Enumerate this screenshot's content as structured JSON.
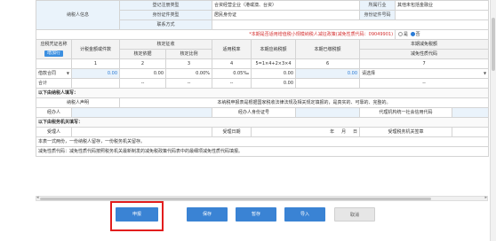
{
  "taxpayer_info": {
    "section_label": "纳税人信息",
    "reg_type_label": "登记注册类型",
    "reg_type_value": "合资经营企业（港或澳、台资）",
    "industry_label": "所属行业",
    "industry_value": "其他未包括金融业",
    "id_type_label": "身份证件类型",
    "id_type_value": "居民身份证",
    "id_no_label": "身份证件号码",
    "contact_label": "联系方式"
  },
  "policy_row": {
    "text": "*本期是否适用增值税小规模纳税人减征政策(减免性质代码：09049901)",
    "yes_label": "是",
    "no_label": "否"
  },
  "headers": {
    "voucher_name": "应税凭证名称",
    "add_button": "增加行",
    "taxable_amount": "计税金额或件数",
    "approved_levy": "核定征收",
    "approved_basis": "核定依据",
    "approved_ratio": "核定比例",
    "tax_rate": "适用税率",
    "tax_payable": "本期应纳税额",
    "tax_paid": "本期已缴税额",
    "relief_label": "本期减免税额",
    "relief_code": "减免性质代码",
    "nums": [
      "1",
      "2",
      "3",
      "4",
      "5=1×4+2×3×4",
      "6",
      "7"
    ]
  },
  "rows": [
    {
      "name": "借款合同",
      "amount": "0.00",
      "basis": "0.00",
      "ratio": "0.00%",
      "rate": "0.05‰",
      "payable": "0.00",
      "paid": "0.00",
      "relief": "请选择"
    }
  ],
  "total_row": {
    "label": "合计",
    "dashes": [
      "--",
      "--",
      "--",
      "--"
    ],
    "payable": "0.00"
  },
  "taxpayer_fill": {
    "heading": "以下由纳税人填写：",
    "declaration_label": "纳税人声明",
    "declaration_text": "本纳税申报表是根据国家税收法律法规及相关规定填报的，是真实的、可靠的、完整的。",
    "agent_label": "经办人",
    "agent_id_label": "经办人身份证号",
    "agency_label": "代理机构统一社会信用代码"
  },
  "tax_office_fill": {
    "heading": "以下由税务机关填写：",
    "receiver_label": "受理人",
    "receive_date_label": "受理日期",
    "year": "年",
    "month": "月",
    "day": "日",
    "office_seal_label": "受理税务机关签章"
  },
  "notes": [
    "本表一式两份，一份纳税人留存，一份税务机关留存。",
    "减免性质代码：减免性质代码按照税务机关最新制发的减免税政策代码表中的最细项减免性质代码填报。"
  ],
  "buttons": {
    "declare": "申报",
    "save": "保存",
    "temp_save": "暂存",
    "import": "导入",
    "cancel": "取消"
  }
}
